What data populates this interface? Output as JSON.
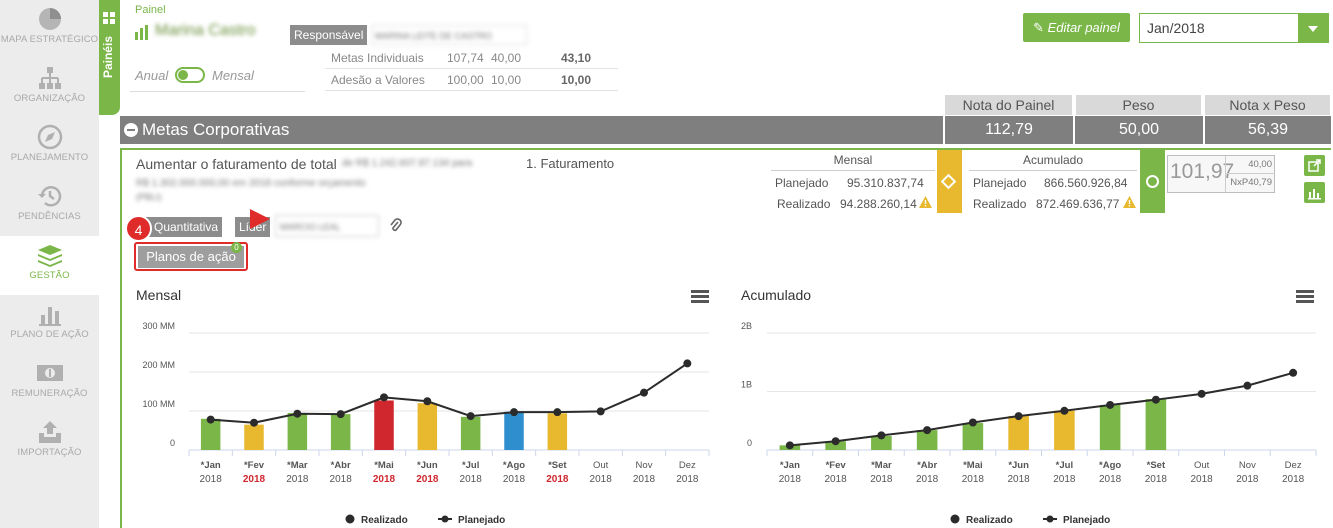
{
  "nav": [
    {
      "label": "MAPA ESTRATÉGICO",
      "icon": "pie-chart-icon"
    },
    {
      "label": "ORGANIZAÇÃO",
      "icon": "org-chart-icon"
    },
    {
      "label": "PLANEJAMENTO",
      "icon": "compass-icon"
    },
    {
      "label": "PENDÊNCIAS",
      "icon": "history-icon"
    },
    {
      "label": "GESTÃO",
      "icon": "layers-icon"
    },
    {
      "label": "PLANO DE AÇÃO",
      "icon": "bar-chart-icon"
    },
    {
      "label": "REMUNERAÇÃO",
      "icon": "money-icon"
    },
    {
      "label": "IMPORTAÇÃO",
      "icon": "upload-icon"
    }
  ],
  "side_tab": "Painéis",
  "header": {
    "painel_label": "Painel",
    "painel_name": "Marina Castro",
    "responsavel_label": "Responsável",
    "responsavel_value": "MARINA LEITE DE CASTRO",
    "toggle_left": "Anual",
    "toggle_right": "Mensal",
    "edit_button": "Editar painel",
    "period": "Jan/2018",
    "summary_rows": [
      {
        "label": "Metas Individuais",
        "v1": "107,74",
        "v2": "40,00",
        "v3": "43,10"
      },
      {
        "label": "Adesão a Valores",
        "v1": "100,00",
        "v2": "10,00",
        "v3": "10,00"
      }
    ]
  },
  "scores": {
    "headers": [
      "Nota do Painel",
      "Peso",
      "Nota x Peso"
    ],
    "section_title": "Metas Corporativas",
    "values": [
      "112,79",
      "50,00",
      "56,39"
    ]
  },
  "goal": {
    "title": "Aumentar o faturamento de total",
    "title_blur": "de R$ 1.242.607.87.134 para",
    "desc_blur": "R$ 1.302.000.000,00 em 2018 conforme orçamento",
    "desc_blur2": "(PBLI)",
    "indicator": "1. Faturamento",
    "badge": "4",
    "chip_type": "Quantitativa",
    "chip_lider": "Líder",
    "lider_value": "MARCIO LEAL",
    "action_button": "Planos de ação",
    "action_count": "0",
    "mensal": {
      "title": "Mensal",
      "plan_label": "Planejado",
      "plan": "95.310.837,74",
      "real_label": "Realizado",
      "real": "94.288.260,14"
    },
    "acumulado": {
      "title": "Acumulado",
      "plan_label": "Planejado",
      "plan": "866.560.926,84",
      "real_label": "Realizado",
      "real": "872.469.636,77"
    },
    "score": "101,97",
    "score_top": "40,00",
    "score_bottom": "NxP40,79",
    "colors": {
      "green": "#7ab648",
      "yellow": "#e8b92f",
      "red": "#d0262e",
      "blue": "#2f8fce"
    }
  },
  "chart_data": [
    {
      "type": "bar",
      "title": "Mensal",
      "categories": [
        "*Jan 2018",
        "*Fev 2018",
        "*Mar 2018",
        "*Abr 2018",
        "*Mai 2018",
        "*Jun 2018",
        "*Jul 2018",
        "*Ago 2018",
        "*Set 2018",
        "Out 2018",
        "Nov 2018",
        "Dez 2018"
      ],
      "month_labels": [
        "*Jan",
        "*Fev",
        "*Mar",
        "*Abr",
        "*Mai",
        "*Jun",
        "*Jul",
        "*Ago",
        "*Set",
        "Out",
        "Nov",
        "Dez"
      ],
      "year_labels": [
        "2018",
        "2018",
        "2018",
        "2018",
        "2018",
        "2018",
        "2018",
        "2018",
        "2018",
        "2018",
        "2018",
        "2018"
      ],
      "year_red": [
        false,
        true,
        false,
        false,
        true,
        true,
        false,
        false,
        true,
        false,
        false,
        false
      ],
      "series": [
        {
          "name": "Realizado",
          "type": "bar",
          "values": [
            80,
            65,
            95,
            92,
            127,
            120,
            85,
            98,
            94,
            null,
            null,
            null
          ],
          "colors": [
            "#7ab648",
            "#e8b92f",
            "#7ab648",
            "#7ab648",
            "#d0262e",
            "#e8b92f",
            "#7ab648",
            "#2f8fce",
            "#e8b92f",
            null,
            null,
            null
          ]
        },
        {
          "name": "Planejado",
          "type": "line",
          "values": [
            78,
            70,
            93,
            92,
            135,
            125,
            87,
            97,
            97,
            99,
            147,
            222
          ]
        }
      ],
      "y_ticks": [
        "0",
        "100 MM",
        "200 MM",
        "300 MM"
      ],
      "ylim": [
        0,
        300
      ],
      "legend": "bottom"
    },
    {
      "type": "bar",
      "title": "Acumulado",
      "categories": [
        "*Jan 2018",
        "*Fev 2018",
        "*Mar 2018",
        "*Abr 2018",
        "*Mai 2018",
        "*Jun 2018",
        "*Jul 2018",
        "*Ago 2018",
        "*Set 2018",
        "Out 2018",
        "Nov 2018",
        "Dez 2018"
      ],
      "month_labels": [
        "*Jan",
        "*Fev",
        "*Mar",
        "*Abr",
        "*Mai",
        "*Jun",
        "*Jul",
        "*Ago",
        "*Set",
        "Out",
        "Nov",
        "Dez"
      ],
      "year_labels": [
        "2018",
        "2018",
        "2018",
        "2018",
        "2018",
        "2018",
        "2018",
        "2018",
        "2018",
        "2018",
        "2018",
        "2018"
      ],
      "year_red": [
        false,
        false,
        false,
        false,
        false,
        false,
        false,
        false,
        false,
        false,
        false,
        false
      ],
      "series": [
        {
          "name": "Realizado",
          "type": "bar",
          "values": [
            0.08,
            0.15,
            0.24,
            0.34,
            0.46,
            0.58,
            0.67,
            0.77,
            0.87,
            null,
            null,
            null
          ],
          "colors": [
            "#7ab648",
            "#7ab648",
            "#7ab648",
            "#7ab648",
            "#7ab648",
            "#e8b92f",
            "#e8b92f",
            "#7ab648",
            "#7ab648",
            null,
            null,
            null
          ]
        },
        {
          "name": "Planejado",
          "type": "line",
          "values": [
            0.08,
            0.15,
            0.25,
            0.34,
            0.47,
            0.58,
            0.67,
            0.77,
            0.86,
            0.96,
            1.1,
            1.32
          ]
        }
      ],
      "y_ticks": [
        "0",
        "1B",
        "2B"
      ],
      "ylim": [
        0,
        2
      ],
      "legend": "bottom"
    }
  ]
}
